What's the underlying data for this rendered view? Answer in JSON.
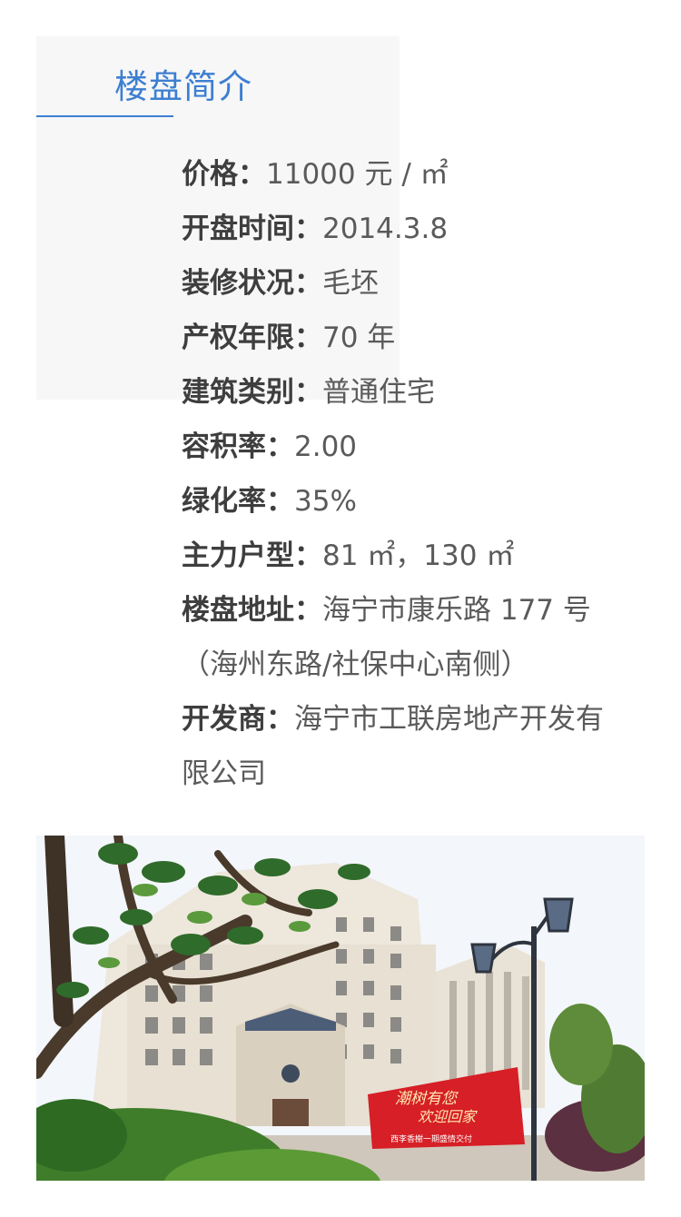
{
  "section": {
    "title": "楼盘简介"
  },
  "info": [
    {
      "label": "价格：",
      "value": "11000 元 / ㎡"
    },
    {
      "label": "开盘时间：",
      "value": "2014.3.8"
    },
    {
      "label": "装修状况：",
      "value": "毛坯"
    },
    {
      "label": "产权年限：",
      "value": "70 年"
    },
    {
      "label": "建筑类别：",
      "value": "普通住宅"
    },
    {
      "label": "容积率：",
      "value": "2.00"
    },
    {
      "label": "绿化率：",
      "value": "35%"
    },
    {
      "label": "主力户型：",
      "value": "81 ㎡，130 ㎡"
    },
    {
      "label": "楼盘地址：",
      "value": "海宁市康乐路 177 号（海州东路/社保中心南侧）"
    },
    {
      "label": "开发商：",
      "value": "海宁市工联房地产开发有限公司"
    }
  ],
  "photo": {
    "banner_line1": "潮树有您",
    "banner_line2": "欢迎回家",
    "banner_line3": "西李香榭一期盛情交付",
    "colors": {
      "accent": "#3d7fd1",
      "banner_red": "#d61f26"
    }
  }
}
